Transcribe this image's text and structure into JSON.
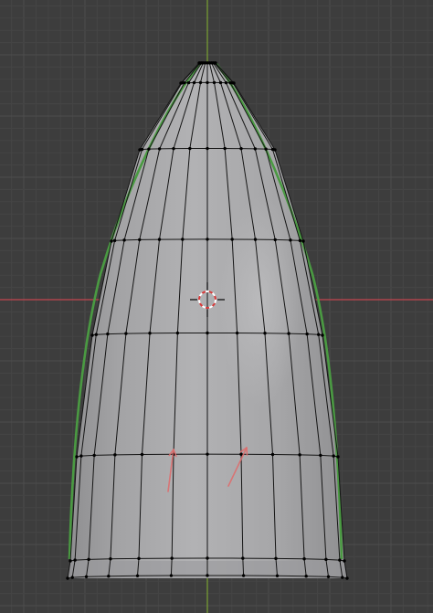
{
  "viewport": {
    "mode": "edit-mode-front-ortho",
    "background_color": "#3d3d3d",
    "grid_minor_color": "#454545",
    "grid_major_color": "#4d4d4d",
    "x_axis_color": "#c4454f",
    "z_axis_color": "#7aa233"
  },
  "mesh": {
    "object": "bullet-shaped-mesh",
    "face_color": "#a9a9ab",
    "edge_color": "#151515",
    "vertex_color": "#000000",
    "guide_curve_color": "#4a9a42",
    "rings": 8,
    "segments": 13
  },
  "cursor": {
    "name": "3d-cursor",
    "ring_color_a": "#ffffff",
    "ring_color_b": "#d83a3a"
  },
  "annotations": {
    "arrow_color": "#e06b6b",
    "count": 2
  }
}
